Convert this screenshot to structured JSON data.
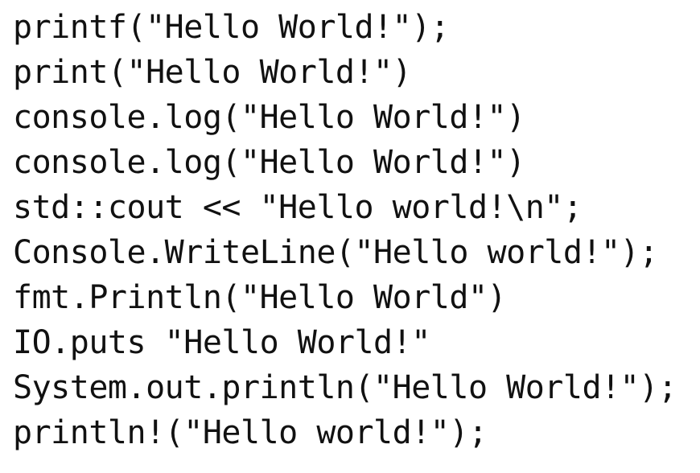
{
  "code": {
    "lines": [
      "printf(\"Hello World!\");",
      "print(\"Hello World!\")",
      "console.log(\"Hello World!\")",
      "console.log(\"Hello World!\")",
      "std::cout << \"Hello world!\\n\";",
      "Console.WriteLine(\"Hello world!\");",
      "fmt.Println(\"Hello World\")",
      "IO.puts \"Hello World!\"",
      "System.out.println(\"Hello World!\");",
      "println!(\"Hello world!\");"
    ]
  },
  "colors": {
    "text": "#111111",
    "background": "#ffffff"
  }
}
